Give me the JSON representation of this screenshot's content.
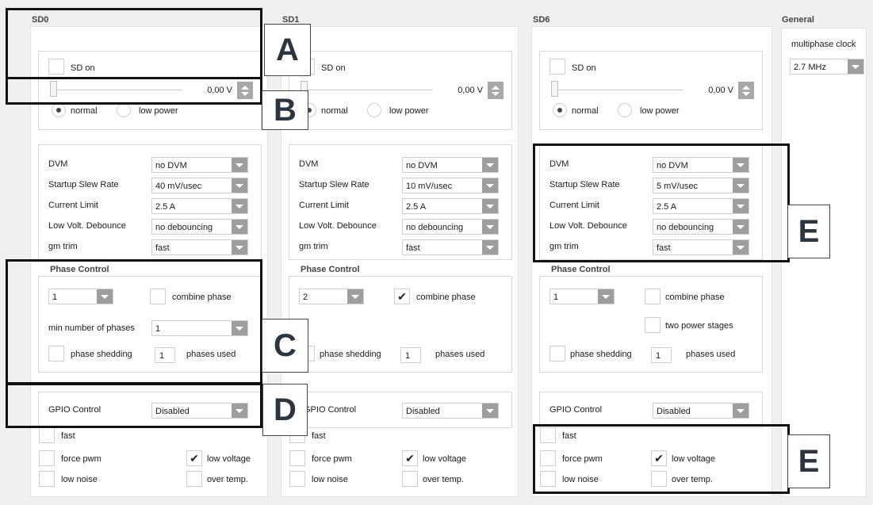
{
  "panels": [
    {
      "title": "SD0",
      "sd_on_label": "SD on",
      "sd_on_checked": false,
      "voltage": "0,00 V",
      "mode_normal": "normal",
      "mode_low": "low power",
      "params": [
        {
          "label": "DVM",
          "value": "no DVM"
        },
        {
          "label": "Startup Slew Rate",
          "value": "40 mV/usec"
        },
        {
          "label": "Current Limit",
          "value": "2.5 A"
        },
        {
          "label": "Low Volt. Debounce",
          "value": "no debouncing"
        },
        {
          "label": "gm trim",
          "value": "fast"
        }
      ],
      "phase_title": "Phase Control",
      "phase_select": "1",
      "combine_label": "combine phase",
      "combine_checked": false,
      "min_phases_label": "min number of phases",
      "min_phases_value": "1",
      "shedding_label": "phase shedding",
      "shedding_checked": false,
      "phases_used_value": "1",
      "phases_used_label": "phases used",
      "gpio_label": "GPIO Control",
      "gpio_value": "Disabled",
      "flags": {
        "fast": "fast",
        "force_pwm": "force pwm",
        "low_noise": "low noise",
        "low_voltage": "low voltage",
        "over_temp": "over temp."
      },
      "flags_checked": {
        "fast": false,
        "force_pwm": false,
        "low_noise": false,
        "low_voltage": true,
        "over_temp": false
      }
    },
    {
      "title": "SD1",
      "sd_on_label": "SD on",
      "sd_on_checked": false,
      "voltage": "0,00 V",
      "mode_normal": "normal",
      "mode_low": "low power",
      "params": [
        {
          "label": "DVM",
          "value": "no DVM"
        },
        {
          "label": "Startup Slew Rate",
          "value": "10 mV/usec"
        },
        {
          "label": "Current Limit",
          "value": "2.5 A"
        },
        {
          "label": "Low Volt. Debounce",
          "value": "no debouncing"
        },
        {
          "label": "gm trim",
          "value": "fast"
        }
      ],
      "phase_title": "Phase Control",
      "phase_select": "2",
      "combine_label": "combine phase",
      "combine_checked": true,
      "shedding_label": "phase shedding",
      "shedding_checked": false,
      "phases_used_value": "1",
      "phases_used_label": "phases used",
      "gpio_label": "GPIO Control",
      "gpio_value": "Disabled",
      "flags": {
        "fast": "fast",
        "force_pwm": "force pwm",
        "low_noise": "low noise",
        "low_voltage": "low voltage",
        "over_temp": "over temp."
      },
      "flags_checked": {
        "fast": false,
        "force_pwm": false,
        "low_noise": false,
        "low_voltage": true,
        "over_temp": false
      }
    },
    {
      "title": "SD6",
      "sd_on_label": "SD on",
      "sd_on_checked": false,
      "voltage": "0,00 V",
      "mode_normal": "normal",
      "mode_low": "low power",
      "params": [
        {
          "label": "DVM",
          "value": "no DVM"
        },
        {
          "label": "Startup Slew Rate",
          "value": "5 mV/usec"
        },
        {
          "label": "Current Limit",
          "value": "2.5 A"
        },
        {
          "label": "Low Volt. Debounce",
          "value": "no debouncing"
        },
        {
          "label": "gm trim",
          "value": "fast"
        }
      ],
      "phase_title": "Phase Control",
      "phase_select": "1",
      "combine_label": "combine phase",
      "combine_checked": false,
      "two_stages_label": "two power stages",
      "two_stages_checked": false,
      "shedding_label": "phase shedding",
      "shedding_checked": false,
      "phases_used_value": "1",
      "phases_used_label": "phases used",
      "gpio_label": "GPIO Control",
      "gpio_value": "Disabled",
      "flags": {
        "fast": "fast",
        "force_pwm": "force pwm",
        "low_noise": "low noise",
        "low_voltage": "low voltage",
        "over_temp": "over temp."
      },
      "flags_checked": {
        "fast": false,
        "force_pwm": false,
        "low_noise": false,
        "low_voltage": true,
        "over_temp": false
      }
    }
  ],
  "general": {
    "title": "General",
    "clock_label": "multiphase clock",
    "clock_value": "2.7 MHz"
  },
  "annotations": {
    "a": "A",
    "b": "B",
    "c": "C",
    "d": "D",
    "e1": "E",
    "e2": "E"
  }
}
